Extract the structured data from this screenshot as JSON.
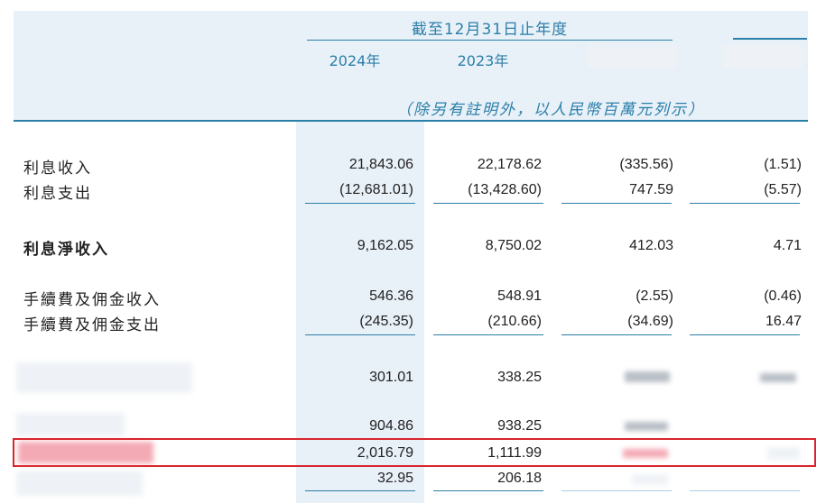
{
  "header": {
    "period": "截至12月31日止年度",
    "years": [
      "2024年",
      "2023年"
    ],
    "unit": "（除另有註明外，以人民幣百萬元列示）"
  },
  "rows": [
    {
      "label": "利息收入",
      "v2024": "21,843.06",
      "v2023": "22,178.62",
      "change": "(335.56)",
      "pct": "(1.51)"
    },
    {
      "label": "利息支出",
      "v2024": "(12,681.01)",
      "v2023": "(13,428.60)",
      "change": "747.59",
      "pct": "(5.57)"
    },
    {
      "label": "利息淨收入",
      "v2024": "9,162.05",
      "v2023": "8,750.02",
      "change": "412.03",
      "pct": "4.71"
    },
    {
      "label": "手續費及佣金收入",
      "v2024": "546.36",
      "v2023": "548.91",
      "change": "(2.55)",
      "pct": "(0.46)"
    },
    {
      "label": "手續費及佣金支出",
      "v2024": "(245.35)",
      "v2023": "(210.66)",
      "change": "(34.69)",
      "pct": "16.47"
    },
    {
      "label": "",
      "v2024": "301.01",
      "v2023": "338.25"
    },
    {
      "label": "",
      "v2024": "904.86",
      "v2023": "938.25"
    },
    {
      "label": "",
      "v2024": "2,016.79",
      "v2023": "1,111.99"
    },
    {
      "label": "",
      "v2024": "32.95",
      "v2023": "206.18"
    }
  ],
  "colors": {
    "accent": "#2b7fa8",
    "band": "#e8f0f8",
    "highlight": "#d9252e"
  }
}
